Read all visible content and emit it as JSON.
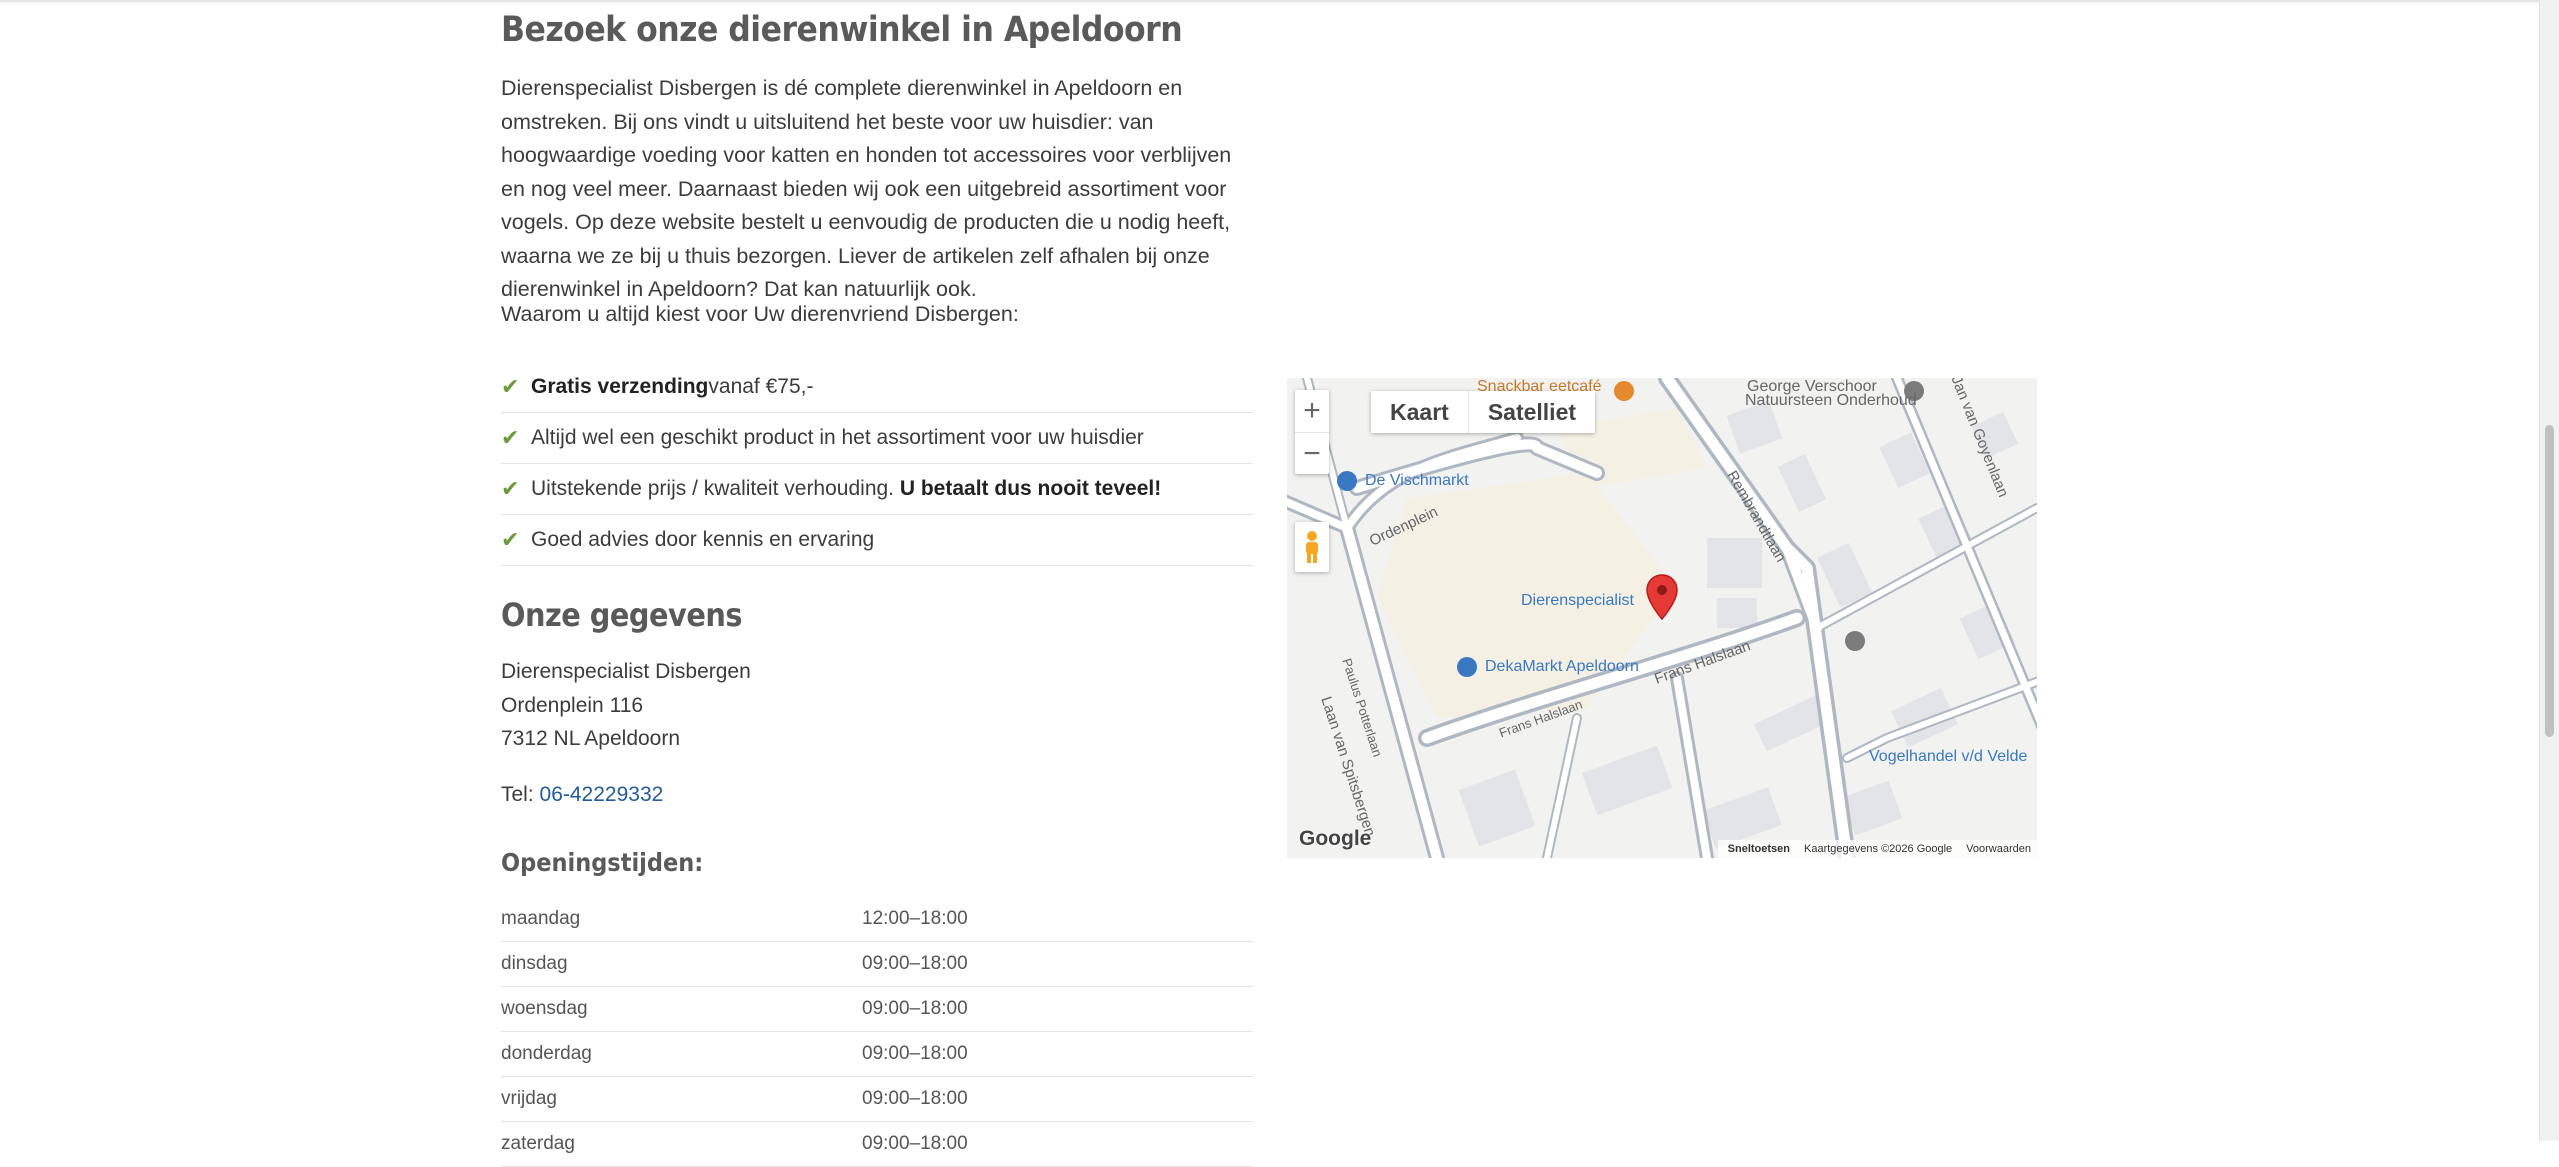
{
  "heading": "Bezoek onze dierenwinkel in Apeldoorn",
  "intro": "Dierenspecialist Disbergen is dé complete dierenwinkel in Apeldoorn en omstreken. Bij ons vindt u uitsluitend het beste voor uw huisdier: van hoogwaardige voeding voor katten en honden tot accessoires voor verblijven en nog veel meer. Daarnaast bieden wij ook een uitgebreid assortiment voor vogels. Op deze website bestelt u eenvoudig de producten die u nodig heeft, waarna we ze bij u thuis bezorgen. Liever de artikelen zelf afhalen bij onze dierenwinkel in Apeldoorn? Dat kan natuurlijk ook.",
  "why_heading": "Waarom u altijd kiest voor Uw dierenvriend Disbergen:",
  "usps": [
    {
      "bold": "Gratis verzending",
      "text": " vanaf €75,-",
      "bold_end": ""
    },
    {
      "bold": "",
      "text": "Altijd wel een geschikt product in het assortiment voor uw huisdier",
      "bold_end": ""
    },
    {
      "bold": "",
      "text": "Uitstekende prijs / kwaliteit verhouding. ",
      "bold_end": "U betaalt dus nooit teveel!"
    },
    {
      "bold": "",
      "text": "Goed advies door kennis en ervaring",
      "bold_end": ""
    }
  ],
  "contact": {
    "heading": "Onze gegevens",
    "name": "Dierenspecialist Disbergen",
    "street": "Ordenplein 116",
    "city": "7312 NL Apeldoorn",
    "tel_label": "Tel: ",
    "tel": "06-42229332"
  },
  "hours": {
    "heading": "Openingstijden:",
    "rows": [
      {
        "day": "maandag",
        "time": "12:00–18:00"
      },
      {
        "day": "dinsdag",
        "time": "09:00–18:00"
      },
      {
        "day": "woensdag",
        "time": "09:00–18:00"
      },
      {
        "day": "donderdag",
        "time": "09:00–18:00"
      },
      {
        "day": "vrijdag",
        "time": "09:00–18:00"
      },
      {
        "day": "zaterdag",
        "time": "09:00–18:00"
      }
    ]
  },
  "map": {
    "type_map": "Kaart",
    "type_satellite": "Satelliet",
    "zoom_in": "+",
    "zoom_out": "−",
    "logo": "Google",
    "shortcuts": "Sneltoetsen",
    "attribution": "Kaartgegevens ©2026 Google",
    "terms": "Voorwaarden",
    "labels": {
      "snackbar": "Snackbar eetcafé",
      "verschoor1": "George Verschoor",
      "verschoor2": "Natuursteen Onderhoud",
      "vischmarkt": "De Vischmarkt",
      "ordenplein": "Ordenplein",
      "rembrandtlaan": "Rembrandtlaan",
      "jan_van_goyen": "Jan van Goyenlaan",
      "dierenspecialist": "Dierenspecialist",
      "dekamarkt": "DekaMarkt Apeldoorn",
      "frans_halslaan_1": "Frans Halslaan",
      "frans_halslaan_2": "Frans Halslaan",
      "paulus_potterlaan": "Paulus Potterlaan",
      "laan_van_spitsbergen": "Laan van Spitsbergen",
      "vogelhandel": "Vogelhandel v/d Velde"
    }
  },
  "colors": {
    "check": "#6b9a3a",
    "link": "#1f5c99",
    "heading": "#5a5a5a",
    "pin": "#e53935"
  }
}
